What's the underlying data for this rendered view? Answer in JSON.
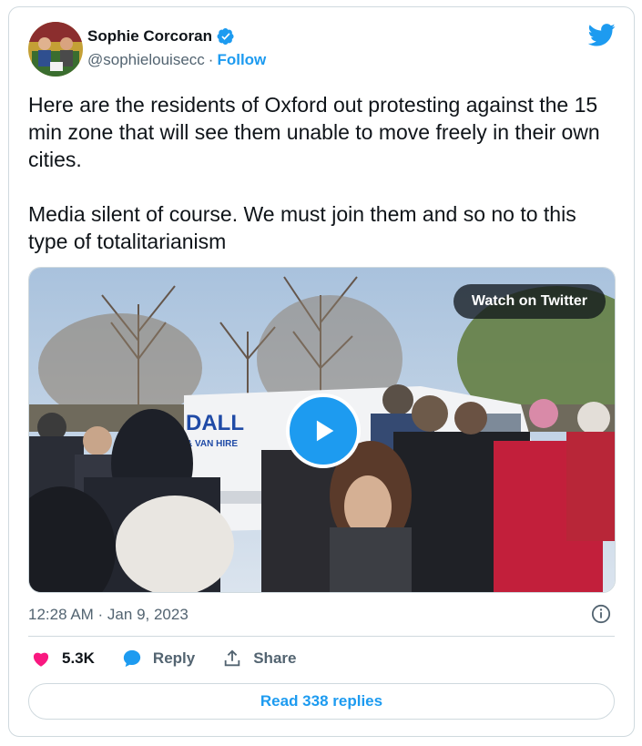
{
  "author": {
    "name": "Sophie Corcoran",
    "handle": "@sophielouisecc",
    "separator": "·",
    "follow_label": "Follow",
    "verified": true
  },
  "tweet": {
    "text": "Here are the residents of Oxford out protesting against the 15 min zone that will see them unable to move freely in their own cities.\n\nMedia silent of course. We must join them and so no to this type of totalitarianism"
  },
  "media": {
    "watch_label": "Watch on Twitter",
    "play_icon": "play-icon",
    "van_text_1": "DALL",
    "van_text_2": "& VAN HIRE"
  },
  "timestamp": "12:28 AM · Jan 9, 2023",
  "actions": {
    "like_count": "5.3K",
    "reply_label": "Reply",
    "share_label": "Share"
  },
  "read_replies_label": "Read 338 replies",
  "colors": {
    "accent": "#1d9bf0",
    "like": "#f91880",
    "text": "#0f1419",
    "secondary": "#536471",
    "border": "#cfd9de"
  }
}
